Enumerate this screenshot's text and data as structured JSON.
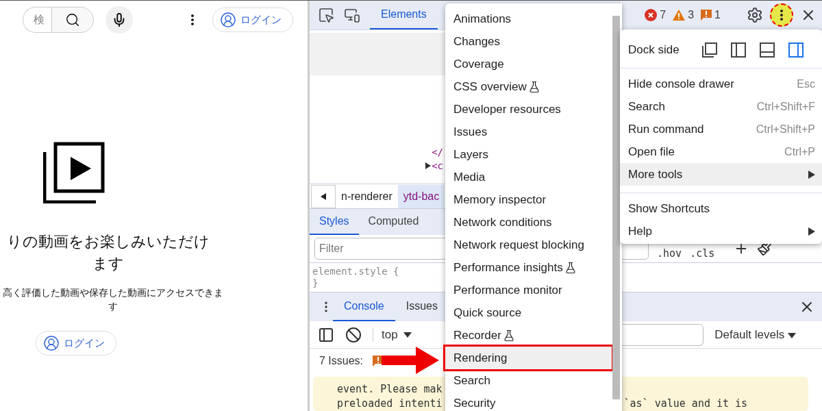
{
  "page": {
    "search": {
      "placeholder": "検"
    },
    "login_top": "ログイン",
    "empty_title": "りの動画をお楽しみいただけます",
    "empty_text": "高く評価した動画や保存した動画にアクセスできます",
    "login_button": "ログイン"
  },
  "devtools": {
    "tabs": [
      {
        "label": "Elements",
        "selected": true
      }
    ],
    "counts": [
      {
        "kind": "error",
        "value": "7"
      },
      {
        "kind": "warning",
        "value": "3"
      },
      {
        "kind": "issue",
        "value": "1"
      }
    ],
    "menu_button": {
      "marked": true
    },
    "dom_lines": [
      {
        "text": "</",
        "expandable": false
      },
      {
        "text": "<c",
        "expandable": true
      }
    ],
    "breadcrumbs": [
      {
        "label": "n-renderer",
        "selected": false
      },
      {
        "label": "ytd-bac",
        "selected": true
      }
    ],
    "styles_tabs": [
      {
        "label": "Styles",
        "selected": true
      },
      {
        "label": "Computed",
        "selected": false
      }
    ],
    "filter": {
      "placeholder": "Filter"
    },
    "style_buttons": [
      ".hov",
      ".cls"
    ],
    "style_rule": [
      "element.style {",
      "}"
    ],
    "drawer_tabs": [
      {
        "label": "Console",
        "selected": true
      },
      {
        "label": "Issues",
        "selected": false
      }
    ],
    "console": {
      "context": "top",
      "levels": "Default levels",
      "issues_label": "7 Issues:",
      "message_left": [
        "event. Please mak",
        "preloaded intenti"
      ],
      "message_right": [
        "`as` value and it is"
      ]
    }
  },
  "more_tools_menu": [
    {
      "label": "Animations",
      "experimental": false,
      "selected": false,
      "marked": false
    },
    {
      "label": "Changes",
      "experimental": false,
      "selected": false,
      "marked": false
    },
    {
      "label": "Coverage",
      "experimental": false,
      "selected": false,
      "marked": false
    },
    {
      "label": "CSS overview",
      "experimental": true,
      "selected": false,
      "marked": false
    },
    {
      "label": "Developer resources",
      "experimental": false,
      "selected": false,
      "marked": false
    },
    {
      "label": "Issues",
      "experimental": false,
      "selected": false,
      "marked": false
    },
    {
      "label": "Layers",
      "experimental": false,
      "selected": false,
      "marked": false
    },
    {
      "label": "Media",
      "experimental": false,
      "selected": false,
      "marked": false
    },
    {
      "label": "Memory inspector",
      "experimental": false,
      "selected": false,
      "marked": false
    },
    {
      "label": "Network conditions",
      "experimental": false,
      "selected": false,
      "marked": false
    },
    {
      "label": "Network request blocking",
      "experimental": false,
      "selected": false,
      "marked": false
    },
    {
      "label": "Performance insights",
      "experimental": true,
      "selected": false,
      "marked": false
    },
    {
      "label": "Performance monitor",
      "experimental": false,
      "selected": false,
      "marked": false
    },
    {
      "label": "Quick source",
      "experimental": false,
      "selected": false,
      "marked": false
    },
    {
      "label": "Recorder",
      "experimental": true,
      "selected": false,
      "marked": false
    },
    {
      "label": "Rendering",
      "experimental": false,
      "selected": true,
      "marked": true
    },
    {
      "label": "Search",
      "experimental": false,
      "selected": false,
      "marked": false
    },
    {
      "label": "Security",
      "experimental": false,
      "selected": false,
      "marked": false
    }
  ],
  "main_menu": {
    "dock_label": "Dock side",
    "dock_options": [
      {
        "kind": "undock",
        "selected": false
      },
      {
        "kind": "left",
        "selected": false
      },
      {
        "kind": "bottom",
        "selected": false
      },
      {
        "kind": "right",
        "selected": true
      }
    ],
    "groups": [
      [
        {
          "label": "Hide console drawer",
          "shortcut": "Esc",
          "submenu": false,
          "selected": false
        },
        {
          "label": "Search",
          "shortcut": "Ctrl+Shift+F",
          "submenu": false,
          "selected": false
        },
        {
          "label": "Run command",
          "shortcut": "Ctrl+Shift+P",
          "submenu": false,
          "selected": false
        },
        {
          "label": "Open file",
          "shortcut": "Ctrl+P",
          "submenu": false,
          "selected": false
        },
        {
          "label": "More tools",
          "submenu": true,
          "selected": true
        }
      ],
      [
        {
          "label": "Show Shortcuts",
          "submenu": false,
          "selected": false
        },
        {
          "label": "Help",
          "submenu": true,
          "selected": false
        }
      ]
    ]
  }
}
